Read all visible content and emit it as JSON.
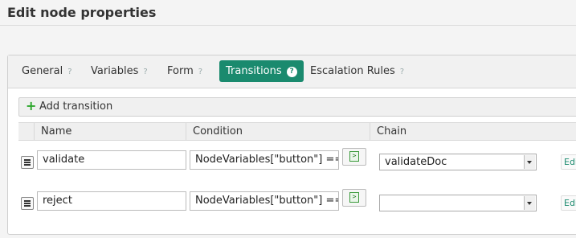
{
  "page": {
    "title": "Edit node properties"
  },
  "tabs": [
    {
      "label": "General",
      "help": "?"
    },
    {
      "label": "Variables",
      "help": "?"
    },
    {
      "label": "Form",
      "help": "?"
    },
    {
      "label": "Transitions",
      "help": "?",
      "active": true
    },
    {
      "label": "Escalation Rules",
      "help": "?"
    }
  ],
  "transitions": {
    "add_label": "Add transition",
    "columns": {
      "name": "Name",
      "condition": "Condition",
      "chain": "Chain"
    },
    "rows": [
      {
        "name": "validate",
        "condition": "NodeVariables[\"button\"] ==",
        "chain": "validateDoc",
        "edit": "Edit"
      },
      {
        "name": "reject",
        "condition": "NodeVariables[\"button\"] ==",
        "chain": "",
        "edit": "Edit"
      }
    ]
  },
  "colors": {
    "accent": "#1a8a6e",
    "add_icon": "#2aa52a"
  },
  "icons": {
    "add": "plus-icon",
    "drag": "drag-handle-icon",
    "code": "script-editor-icon",
    "dropdown": "chevron-down-icon"
  }
}
